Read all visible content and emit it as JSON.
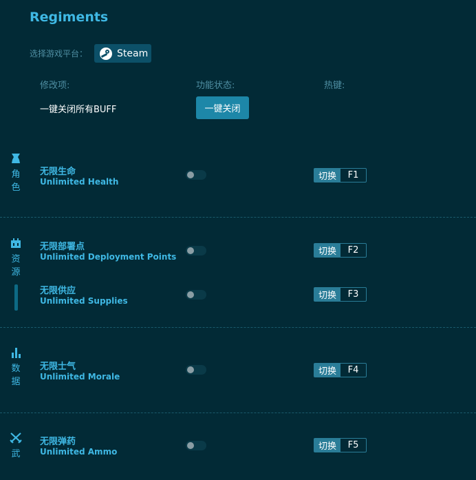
{
  "header": {
    "title": "Regiments",
    "platform_label": "选择游戏平台：",
    "platform_button": "Steam"
  },
  "columns": {
    "mod": "修改项:",
    "status": "功能状态:",
    "hotkey": "热键:"
  },
  "all_off": {
    "label": "一键关闭所有BUFF",
    "button": "一键关闭"
  },
  "hotkey_switch_label": "切换",
  "categories": [
    {
      "name": "角色",
      "icon": "character-icon"
    },
    {
      "name": "资源",
      "icon": "resource-icon"
    },
    {
      "name": "数据",
      "icon": "data-icon"
    },
    {
      "name": "武",
      "icon": "weapon-icon"
    }
  ],
  "mods": [
    {
      "cn": "无限生命",
      "en": "Unlimited Health",
      "key": "F1",
      "enabled": false
    },
    {
      "cn": "无限部署点",
      "en": "Unlimited Deployment Points",
      "key": "F2",
      "enabled": false
    },
    {
      "cn": "无限供应",
      "en": "Unlimited Supplies",
      "key": "F3",
      "enabled": false
    },
    {
      "cn": "无限士气",
      "en": "Unlimited Morale",
      "key": "F4",
      "enabled": false
    },
    {
      "cn": "无限弹药",
      "en": "Unlimited Ammo",
      "key": "F5",
      "enabled": false
    }
  ],
  "colors": {
    "background": "#022a36",
    "accent": "#3fb8e4",
    "button": "#1d87a8",
    "hotkey": "#2a7d98"
  }
}
